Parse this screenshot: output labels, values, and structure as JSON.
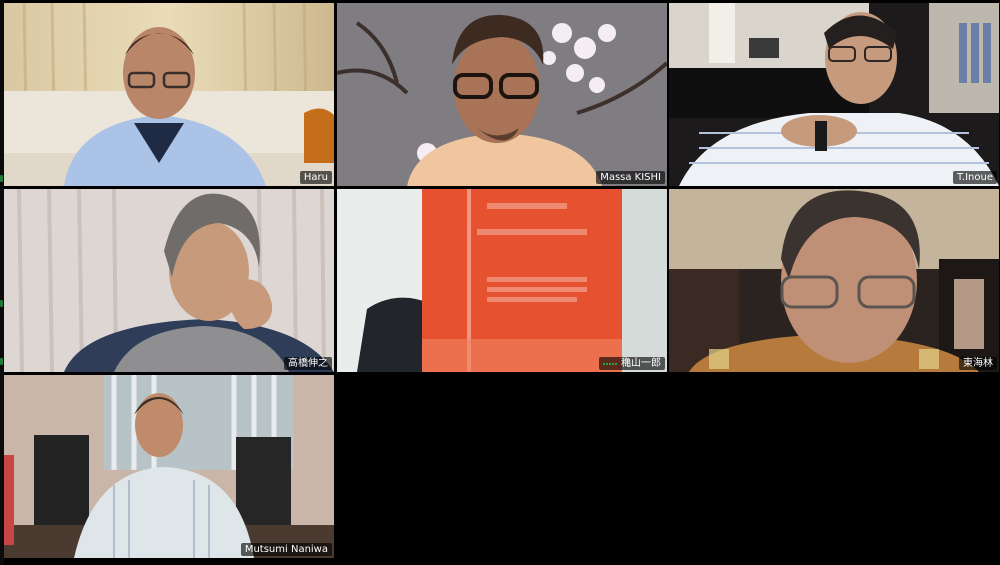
{
  "meeting": {
    "participants": [
      {
        "name": "Haru"
      },
      {
        "name": "Massa KISHI"
      },
      {
        "name": "T.Inoue"
      },
      {
        "name": "高橋伸之"
      },
      {
        "name": "穐山一郎",
        "speaking": true
      },
      {
        "name": "東海林"
      },
      {
        "name": "Mutsumi Naniwa"
      }
    ]
  },
  "colors": {
    "background": "#000000",
    "active_speaker_border": "#23c552",
    "name_tag_text": "#ffffff"
  },
  "icons": {
    "active_speaker": "mic-active-icon"
  }
}
